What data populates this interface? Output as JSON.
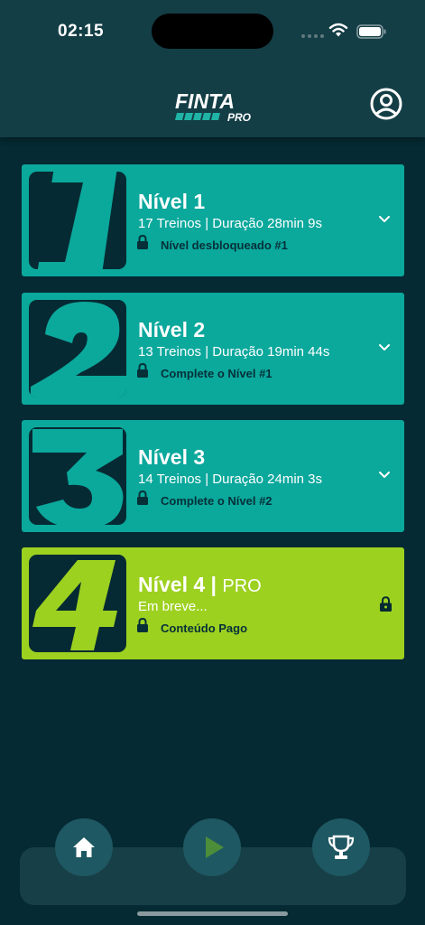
{
  "status_bar": {
    "time": "02:15"
  },
  "app": {
    "logo_text": "FINTA",
    "logo_sub": "PRO"
  },
  "levels": [
    {
      "number": "1",
      "title": "Nível 1",
      "subtitle": "17 Treinos | Duração 28min 9s",
      "status": "Nível desbloqueado #1"
    },
    {
      "number": "2",
      "title": "Nível 2",
      "subtitle": "13 Treinos | Duração 19min 44s",
      "status": "Complete o Nível #1"
    },
    {
      "number": "3",
      "title": "Nível 3",
      "subtitle": "14 Treinos | Duração 24min 3s",
      "status": "Complete o Nível #2"
    },
    {
      "number": "4",
      "title": "Nível 4",
      "separator": "|",
      "tag": "PRO",
      "subtitle": "Em breve...",
      "status": "Conteúdo Pago"
    }
  ],
  "bottom_nav": [
    {
      "icon": "home-icon"
    },
    {
      "icon": "play-icon"
    },
    {
      "icon": "trophy-icon"
    }
  ],
  "colors": {
    "background": "#052a33",
    "header": "#143e46",
    "card_teal": "#0ba89c",
    "card_pro": "#9dd120",
    "nav_button": "#1e5862"
  }
}
